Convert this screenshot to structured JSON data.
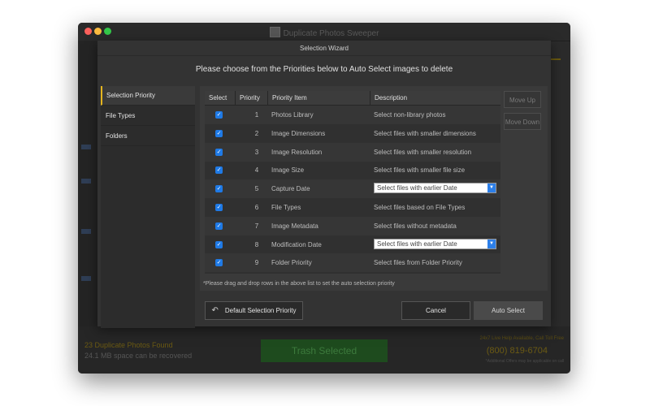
{
  "window": {
    "title": "Duplicate Photos Sweeper"
  },
  "background": {
    "duplicates_found": "23 Duplicate Photos Found",
    "space_recoverable": "24.1 MB space can be recovered",
    "trash_button": "Trash Selected",
    "help_line": "24x7 Live Help Available, Call Toll Free",
    "phone": "(800) 819-6704",
    "offers_note": "*Additional Offers may be applicable on call"
  },
  "dialog": {
    "title": "Selection Wizard",
    "heading": "Please choose from the Priorities below to Auto Select images to delete",
    "sidebar": [
      {
        "label": "Selection Priority",
        "active": true
      },
      {
        "label": "File Types",
        "active": false
      },
      {
        "label": "Folders",
        "active": false
      }
    ],
    "table": {
      "headers": [
        "Select",
        "Priority",
        "Priority Item",
        "Description"
      ],
      "rows": [
        {
          "checked": true,
          "priority": "1",
          "item": "Photos Library",
          "description": "Select non-library photos",
          "dropdown": false
        },
        {
          "checked": true,
          "priority": "2",
          "item": "Image Dimensions",
          "description": "Select files with smaller dimensions",
          "dropdown": false
        },
        {
          "checked": true,
          "priority": "3",
          "item": "Image Resolution",
          "description": "Select files with smaller resolution",
          "dropdown": false
        },
        {
          "checked": true,
          "priority": "4",
          "item": "Image Size",
          "description": "Select files with smaller file size",
          "dropdown": false
        },
        {
          "checked": true,
          "priority": "5",
          "item": "Capture Date",
          "description": "Select files with earlier Date",
          "dropdown": true
        },
        {
          "checked": true,
          "priority": "6",
          "item": "File Types",
          "description": "Select files based on File Types",
          "dropdown": false
        },
        {
          "checked": true,
          "priority": "7",
          "item": "Image Metadata",
          "description": "Select files without metadata",
          "dropdown": false
        },
        {
          "checked": true,
          "priority": "8",
          "item": "Modification Date",
          "description": "Select files with earlier Date",
          "dropdown": true
        },
        {
          "checked": true,
          "priority": "9",
          "item": "Folder Priority",
          "description": "Select files from Folder Priority",
          "dropdown": false
        }
      ]
    },
    "move_up": "Move Up",
    "move_down": "Move Down",
    "note": "*Please drag and drop rows in the above list to set the auto selection priority",
    "default_button": "Default Selection Priority",
    "cancel_button": "Cancel",
    "auto_select_button": "Auto Select"
  },
  "colors": {
    "accent": "#e5b51f",
    "checkbox": "#1f7ae6",
    "dropdown_arrow": "#2d7fe8"
  },
  "icons": {
    "back": "back-arrow-icon",
    "check": "checkmark-icon",
    "dropdown": "chevron-down-icon"
  }
}
